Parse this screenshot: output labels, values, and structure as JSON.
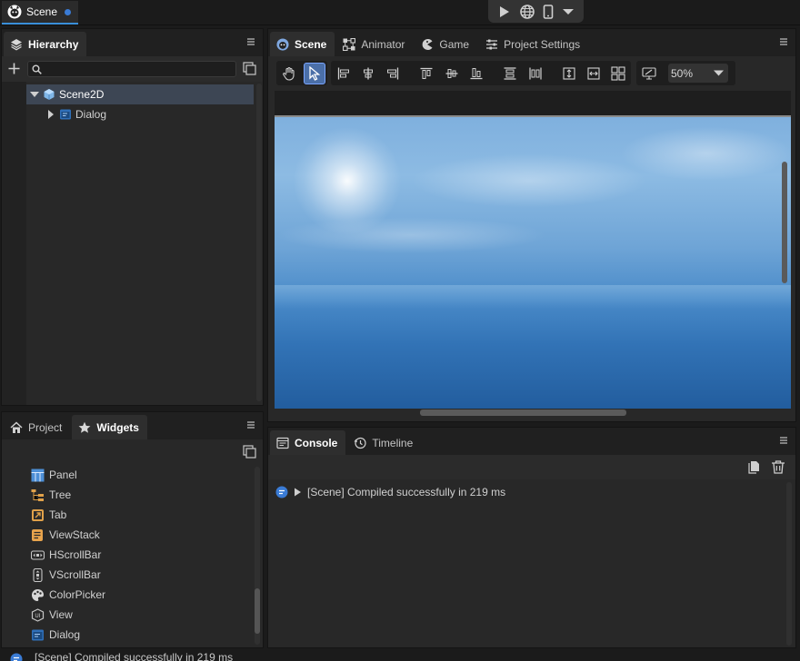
{
  "top": {
    "doc_tab_label": "Scene"
  },
  "hierarchy": {
    "tab_label": "Hierarchy",
    "search_placeholder": "",
    "items": [
      {
        "label": "Scene2D"
      },
      {
        "label": "Dialog"
      }
    ]
  },
  "bottom_left": {
    "tabs": [
      {
        "label": "Project"
      },
      {
        "label": "Widgets"
      }
    ],
    "widgets": [
      {
        "label": "Panel"
      },
      {
        "label": "Tree"
      },
      {
        "label": "Tab"
      },
      {
        "label": "ViewStack"
      },
      {
        "label": "HScrollBar"
      },
      {
        "label": "VScrollBar"
      },
      {
        "label": "ColorPicker"
      },
      {
        "label": "View"
      },
      {
        "label": "Dialog"
      }
    ]
  },
  "editor": {
    "tabs": [
      {
        "label": "Scene"
      },
      {
        "label": "Animator"
      },
      {
        "label": "Game"
      },
      {
        "label": "Project Settings"
      }
    ],
    "zoom": "50%"
  },
  "console": {
    "tabs": [
      {
        "label": "Console"
      },
      {
        "label": "Timeline"
      }
    ],
    "message": "[Scene] Compiled successfully in 219 ms"
  },
  "status": {
    "message": "[Scene] Compiled successfully in 219 ms"
  },
  "colors": {
    "accent": "#3a8fd9",
    "selection": "#3d4654",
    "tool_active": "#4b6fa8"
  }
}
